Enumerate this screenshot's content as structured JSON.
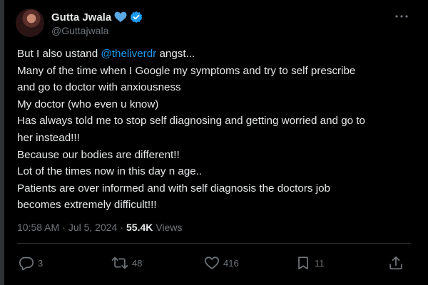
{
  "author": {
    "display_name": "Gutta Jwala",
    "handle": "@Guttajwala"
  },
  "icons": {
    "heart": "blue-heart-icon",
    "verified": "verified-badge-icon",
    "more": "more-dots-icon",
    "reply": "reply-icon",
    "repost": "repost-icon",
    "like": "like-icon",
    "bookmark": "bookmark-icon",
    "share": "share-icon"
  },
  "colors": {
    "background": "#000000",
    "text": "#e7e9ea",
    "secondary": "#71767b",
    "accent": "#1d9bf0",
    "divider": "#2f3336"
  },
  "tweet": {
    "line1_prefix": "But I also ustand ",
    "line1_mention": "@theliverdr",
    "line1_suffix": " angst...",
    "lines": [
      "Many of the time when I Google my symptoms and try to self prescribe",
      "and go to doctor with anxiousness",
      "My doctor (who even u know)",
      "Has always told me to stop self diagnosing and getting worried and go to",
      "her instead!!!",
      "Because our bodies are different!!",
      "Lot of the times now in this day n age..",
      "Patients are over informed and with self diagnosis the doctors job",
      "becomes extremely difficult!!!"
    ]
  },
  "meta": {
    "time": "10:58 AM",
    "dot1": "·",
    "date": "Jul 5, 2024",
    "dot2": "·",
    "views_count": "55.4K",
    "views_label": "Views"
  },
  "actions": {
    "replies": "3",
    "reposts": "48",
    "likes": "416",
    "bookmarks": "11"
  }
}
